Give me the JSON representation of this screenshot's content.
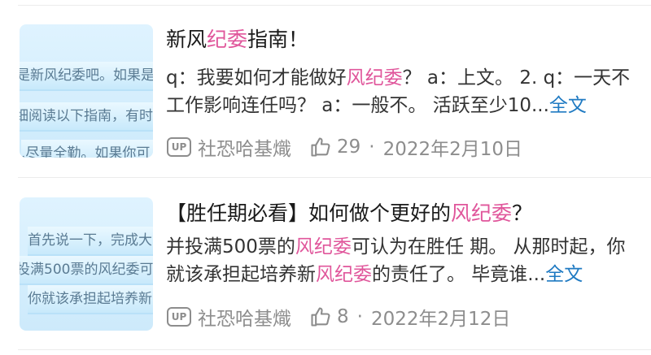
{
  "cards": [
    {
      "thumb_lines": [
        "是新风纪委吧。如果是",
        "细阅读以下指南，有时",
        ".尽量全勤。如果你可"
      ],
      "title": {
        "pre": "新风",
        "hl": "纪委",
        "post": "指南！"
      },
      "excerpt": [
        {
          "t": "q：我要如何才能做好",
          "hl": false
        },
        {
          "t": "风纪委",
          "hl": true
        },
        {
          "t": "？  a：上文。 2. q：一天不工作影响连任吗？  a：一般不。 活跃至少10...",
          "hl": false
        }
      ],
      "more_label": "全文",
      "author": "社恐哈基熾",
      "up_badge": "UP",
      "likes": "29",
      "date": "2022年2月10日"
    },
    {
      "thumb_lines": [
        "首先说一下，完成大",
        "投满500票的风纪委可",
        "你就该承担起培养新"
      ],
      "title": {
        "pre": "【胜任期必看】如何做个更好的",
        "hl": "风纪委",
        "post": "？"
      },
      "excerpt": [
        {
          "t": "并投满500票的",
          "hl": false
        },
        {
          "t": "风纪委",
          "hl": true
        },
        {
          "t": "可认为在胜任 期。 从那时起，你就该承担起培养新",
          "hl": false
        },
        {
          "t": "风纪委",
          "hl": true
        },
        {
          "t": "的责任了。 毕竟谁...",
          "hl": false
        }
      ],
      "more_label": "全文",
      "author": "社恐哈基熾",
      "up_badge": "UP",
      "likes": "8",
      "date": "2022年2月12日"
    }
  ],
  "meta_separator": "·",
  "colors": {
    "highlight": "#e0569b",
    "link": "#1f7ac2",
    "meta": "#8d8d8d"
  },
  "icons": {
    "like": "thumbs-up-icon",
    "up": "up-badge-icon"
  }
}
